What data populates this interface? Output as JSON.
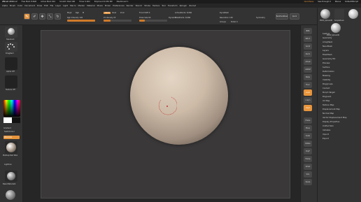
{
  "title_bar": {
    "app": "ZBrush 2019.1.2",
    "items": [
      "Free Mem 8.9GB",
      "Active Mem 601",
      "Scratch Disk 168",
      "Timer 0.002",
      "PolyCount 0.052 MP",
      "MeshCount 1"
    ],
    "right_items": [
      "QuickSave",
      "See-through 0",
      "Menus",
      "DefaultZScript"
    ]
  },
  "menu": [
    "Alpha",
    "Brush",
    "Color",
    "Document",
    "Draw",
    "Edit",
    "File",
    "Layer",
    "Light",
    "Macro",
    "Marker",
    "Material",
    "Movie",
    "Picker",
    "Preferences",
    "Render",
    "Stencil",
    "Stroke",
    "Texture",
    "Tool",
    "Transform",
    "Zplugin",
    "Zscript"
  ],
  "toolbar": {
    "mrgb": "Mrgb",
    "rgb": "Rgb",
    "m": "M",
    "zadd": "Zadd",
    "zsub": "Zsub",
    "zcut": "Zcut",
    "rgb_intensity": "Rgb Intensity 100",
    "z_intensity": "Z Intensity 25",
    "focal_shift": "Focal Shift 0",
    "draw_size": "Draw Size 64",
    "dynamic": "Dynamic",
    "active_points": "ActivePoints: 8,066",
    "total_points": "TotalPoints: 8,066",
    "sdiv": "SDiv",
    "morph": "Morph",
    "persp": "Persp",
    "floor": "Floor",
    "symmetry": "Symmetry",
    "solo": "Solo",
    "transp": "Transp",
    "dynamesh": "DynaMesh",
    "dynamesh_slider": "Resolution 128",
    "groups": "Groups",
    "polish": "Polish 0",
    "backface": "BackfaceMask",
    "transpose": "Transpose",
    "quick": "Quick"
  },
  "left_panel": {
    "brush_label": "Standard",
    "stroke_label": "DragRect",
    "alpha_label": "Alpha Off",
    "texture_label": "Texture Off",
    "gradient_label": "Gradient",
    "switch_color": "SwitchColor",
    "alternate": "Alternate",
    "material_label": "MatCap Red Wax",
    "lightbox": "Lightbox",
    "material2": "BasicMaterial2",
    "zbrush_icon": "ZBrush"
  },
  "right_shelf": [
    "BPR",
    "SPix 3",
    "Scroll",
    "Zoom",
    "Actual",
    "AAHalf",
    "Persp",
    "Floor",
    "Local",
    "L.Sym",
    "Gxyz",
    "Frame",
    "Move",
    "Scale",
    "Rotate",
    "PolyF",
    "Transp",
    "Ghost",
    "Solo",
    "Xpose"
  ],
  "right_menu": {
    "header": [
      "PM3D_Sphere3D",
      "SimpleBrush",
      "SphereBrush",
      "PM3D_Sphere3D"
    ],
    "items": [
      "Subtool",
      "Geometry",
      "ArrayMesh",
      "NanoMesh",
      "Layers",
      "FiberMesh",
      "Geometry HD",
      "Preview",
      "Surface",
      "Deformation",
      "Masking",
      "Visibility",
      "Polygroups",
      "Contact",
      "Morph Target",
      "Polypaint",
      "UV Map",
      "Texture Map",
      "Displacement Map",
      "Normal Map",
      "Vector Displacement Map",
      "Display Properties",
      "Unified Skin",
      "Initialize",
      "Import",
      "Export"
    ]
  },
  "colors": {
    "accent": "#e8953c",
    "background": "#2a2a2a",
    "canvas": "#3a3839",
    "sphere": "#cdbba8"
  }
}
